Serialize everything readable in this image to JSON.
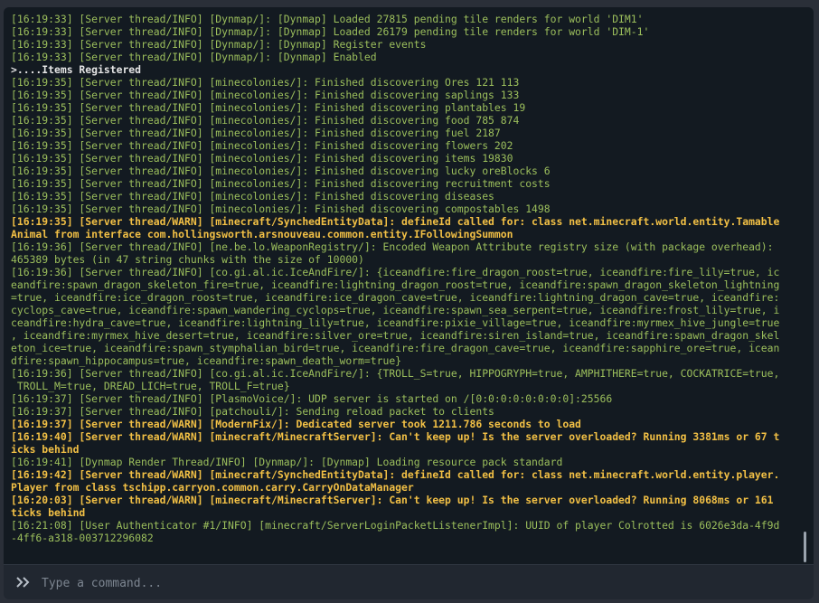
{
  "console": {
    "lines": [
      {
        "type": "info",
        "text": "[16:19:33] [Server thread/INFO] [Dynmap/]: [Dynmap] Loaded 27815 pending tile renders for world 'DIM1'"
      },
      {
        "type": "info",
        "text": "[16:19:33] [Server thread/INFO] [Dynmap/]: [Dynmap] Loaded 26179 pending tile renders for world 'DIM-1'"
      },
      {
        "type": "info",
        "text": "[16:19:33] [Server thread/INFO] [Dynmap/]: [Dynmap] Register events"
      },
      {
        "type": "info",
        "text": "[16:19:33] [Server thread/INFO] [Dynmap/]: [Dynmap] Enabled"
      },
      {
        "type": "plain",
        "text": ">....Items Registered"
      },
      {
        "type": "info",
        "text": "[16:19:35] [Server thread/INFO] [minecolonies/]: Finished discovering Ores 121 113"
      },
      {
        "type": "info",
        "text": "[16:19:35] [Server thread/INFO] [minecolonies/]: Finished discovering saplings 133"
      },
      {
        "type": "info",
        "text": "[16:19:35] [Server thread/INFO] [minecolonies/]: Finished discovering plantables 19"
      },
      {
        "type": "info",
        "text": "[16:19:35] [Server thread/INFO] [minecolonies/]: Finished discovering food 785 874"
      },
      {
        "type": "info",
        "text": "[16:19:35] [Server thread/INFO] [minecolonies/]: Finished discovering fuel 2187"
      },
      {
        "type": "info",
        "text": "[16:19:35] [Server thread/INFO] [minecolonies/]: Finished discovering flowers 202"
      },
      {
        "type": "info",
        "text": "[16:19:35] [Server thread/INFO] [minecolonies/]: Finished discovering items 19830"
      },
      {
        "type": "info",
        "text": "[16:19:35] [Server thread/INFO] [minecolonies/]: Finished discovering lucky oreBlocks 6"
      },
      {
        "type": "info",
        "text": "[16:19:35] [Server thread/INFO] [minecolonies/]: Finished discovering recruitment costs"
      },
      {
        "type": "info",
        "text": "[16:19:35] [Server thread/INFO] [minecolonies/]: Finished discovering diseases"
      },
      {
        "type": "info",
        "text": "[16:19:35] [Server thread/INFO] [minecolonies/]: Finished discovering compostables 1498"
      },
      {
        "type": "warn",
        "text": "[16:19:35] [Server thread/WARN] [minecraft/SynchedEntityData]: defineId called for: class net.minecraft.world.entity.Tamable\nAnimal from interface com.hollingsworth.arsnouveau.common.entity.IFollowingSummon"
      },
      {
        "type": "info",
        "text": "[16:19:36] [Server thread/INFO] [ne.be.lo.WeaponRegistry/]: Encoded Weapon Attribute registry size (with package overhead):\n465389 bytes (in 47 string chunks with the size of 10000)"
      },
      {
        "type": "info",
        "text": "[16:19:36] [Server thread/INFO] [co.gi.al.ic.IceAndFire/]: {iceandfire:fire_dragon_roost=true, iceandfire:fire_lily=true, ic\neandfire:spawn_dragon_skeleton_fire=true, iceandfire:lightning_dragon_roost=true, iceandfire:spawn_dragon_skeleton_lightning\n=true, iceandfire:ice_dragon_roost=true, iceandfire:ice_dragon_cave=true, iceandfire:lightning_dragon_cave=true, iceandfire:\ncyclops_cave=true, iceandfire:spawn_wandering_cyclops=true, iceandfire:spawn_sea_serpent=true, iceandfire:frost_lily=true, i\nceandfire:hydra_cave=true, iceandfire:lightning_lily=true, iceandfire:pixie_village=true, iceandfire:myrmex_hive_jungle=true\n, iceandfire:myrmex_hive_desert=true, iceandfire:silver_ore=true, iceandfire:siren_island=true, iceandfire:spawn_dragon_skel\neton_ice=true, iceandfire:spawn_stymphalian_bird=true, iceandfire:fire_dragon_cave=true, iceandfire:sapphire_ore=true, icean\ndfire:spawn_hippocampus=true, iceandfire:spawn_death_worm=true}"
      },
      {
        "type": "info",
        "text": "[16:19:36] [Server thread/INFO] [co.gi.al.ic.IceAndFire/]: {TROLL_S=true, HIPPOGRYPH=true, AMPHITHERE=true, COCKATRICE=true,\n TROLL_M=true, DREAD_LICH=true, TROLL_F=true}"
      },
      {
        "type": "info",
        "text": "[16:19:37] [Server thread/INFO] [PlasmoVoice/]: UDP server is started on /[0:0:0:0:0:0:0:0]:25566"
      },
      {
        "type": "info",
        "text": "[16:19:37] [Server thread/INFO] [patchouli/]: Sending reload packet to clients"
      },
      {
        "type": "warn",
        "text": "[16:19:37] [Server thread/WARN] [ModernFix/]: Dedicated server took 1211.786 seconds to load"
      },
      {
        "type": "warn",
        "text": "[16:19:40] [Server thread/WARN] [minecraft/MinecraftServer]: Can't keep up! Is the server overloaded? Running 3381ms or 67 t\nicks behind"
      },
      {
        "type": "info",
        "text": "[16:19:41] [Dynmap Render Thread/INFO] [Dynmap/]: [Dynmap] Loading resource pack standard"
      },
      {
        "type": "warn",
        "text": "[16:19:42] [Server thread/WARN] [minecraft/SynchedEntityData]: defineId called for: class net.minecraft.world.entity.player.\nPlayer from class tschipp.carryon.common.carry.CarryOnDataManager"
      },
      {
        "type": "warn",
        "text": "[16:20:03] [Server thread/WARN] [minecraft/MinecraftServer]: Can't keep up! Is the server overloaded? Running 8068ms or 161\nticks behind"
      },
      {
        "type": "info",
        "text": "[16:21:08] [User Authenticator #1/INFO] [minecraft/ServerLoginPacketListenerImpl]: UUID of player Colrotted is 6026e3da-4f9d\n-4ff6-a318-003712296082"
      }
    ]
  },
  "input": {
    "placeholder": "Type a command...",
    "value": "",
    "icon": "double-chevron-right-icon"
  },
  "colors": {
    "info": "#9cbf5c",
    "warn": "#f2c045",
    "plain": "#e6e6e6",
    "background": "#131a21"
  }
}
